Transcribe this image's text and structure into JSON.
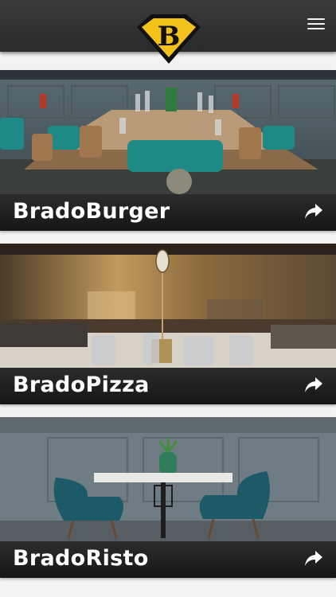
{
  "header": {
    "logo_letter": "B",
    "menu_icon": "hamburger-menu-icon"
  },
  "cards": [
    {
      "title": "BradoBurger",
      "icon": "share-arrow-icon",
      "photo": "restaurant-interior-long-table-teal-chairs"
    },
    {
      "title": "BradoPizza",
      "icon": "share-arrow-icon",
      "photo": "restaurant-interior-table-number-candles"
    },
    {
      "title": "BradoRisto",
      "icon": "share-arrow-icon",
      "photo": "marble-table-two-velvet-chairs-plant"
    }
  ],
  "colors": {
    "header_bg": "#2f2f2f",
    "logo_yellow": "#f2c21a",
    "card_bar_bg": "#1f1f1f",
    "title_text": "#ffffff"
  }
}
